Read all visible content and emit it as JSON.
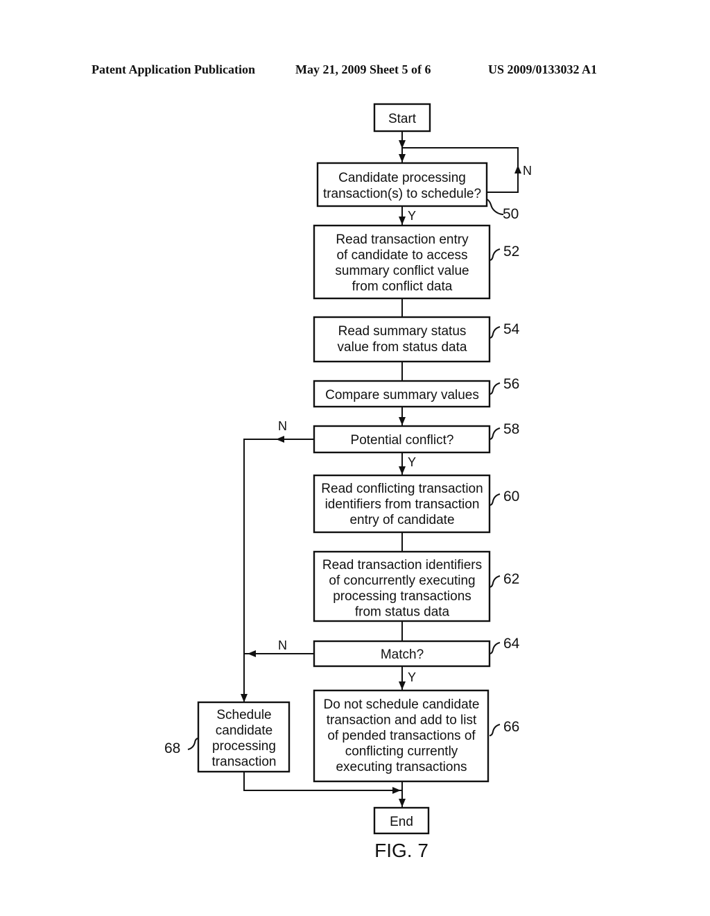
{
  "header": {
    "publication": "Patent Application Publication",
    "date_sheet": "May 21, 2009  Sheet 5 of 6",
    "patent_number": "US 2009/0133032 A1"
  },
  "figure_label": "FIG. 7",
  "nodes": {
    "start": {
      "lines": [
        "Start"
      ]
    },
    "n50": {
      "ref": "50",
      "lines": [
        "Candidate processing",
        "transaction(s) to schedule?"
      ]
    },
    "n52": {
      "ref": "52",
      "lines": [
        "Read transaction entry",
        "of candidate to access",
        "summary conflict value",
        "from conflict data"
      ]
    },
    "n54": {
      "ref": "54",
      "lines": [
        "Read summary status",
        "value from status data"
      ]
    },
    "n56": {
      "ref": "56",
      "lines": [
        "Compare summary values"
      ]
    },
    "n58": {
      "ref": "58",
      "lines": [
        "Potential conflict?"
      ]
    },
    "n60": {
      "ref": "60",
      "lines": [
        "Read conflicting transaction",
        "identifiers from transaction",
        "entry of candidate"
      ]
    },
    "n62": {
      "ref": "62",
      "lines": [
        "Read transaction identifiers",
        "of concurrently executing",
        "processing transactions",
        "from status data"
      ]
    },
    "n64": {
      "ref": "64",
      "lines": [
        "Match?"
      ]
    },
    "n66": {
      "ref": "66",
      "lines": [
        "Do not schedule candidate",
        "transaction and add to list",
        "of pended transactions of",
        "conflicting currently",
        "executing transactions"
      ]
    },
    "n68": {
      "ref": "68",
      "lines": [
        "Schedule",
        "candidate",
        "processing",
        "transaction"
      ]
    },
    "end": {
      "lines": [
        "End"
      ]
    }
  },
  "branch_labels": {
    "n50_no": "N",
    "n50_yes": "Y",
    "n58_no": "N",
    "n58_yes": "Y",
    "n64_no": "N",
    "n64_yes": "Y"
  }
}
